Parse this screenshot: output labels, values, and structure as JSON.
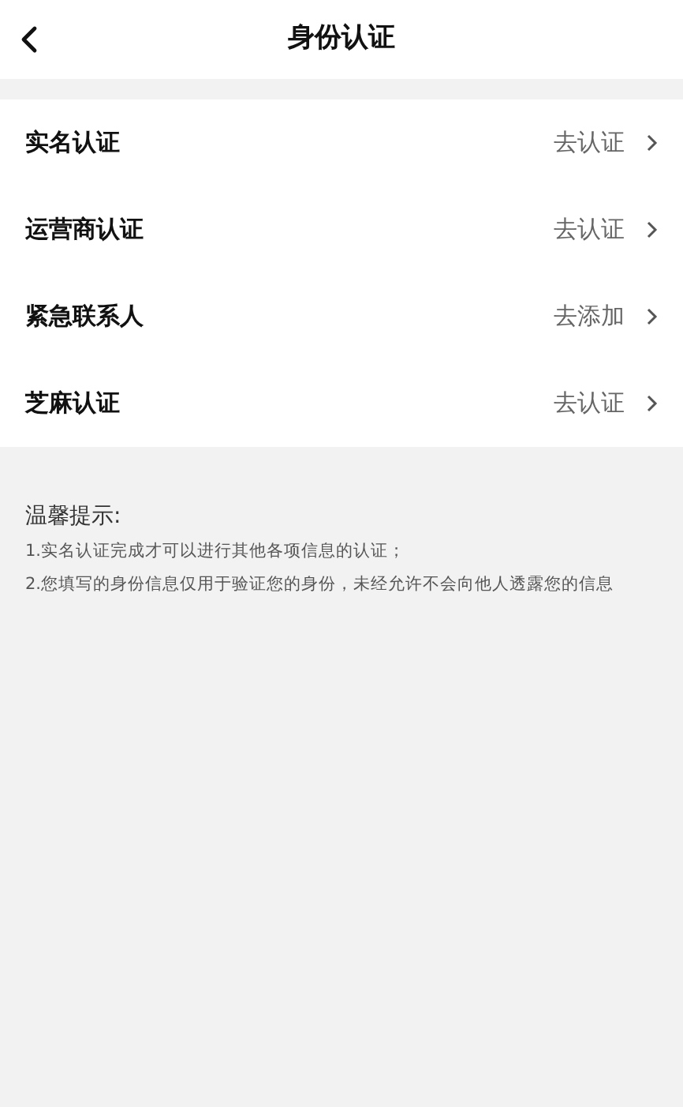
{
  "header": {
    "title": "身份认证"
  },
  "items": [
    {
      "label": "实名认证",
      "action": "去认证"
    },
    {
      "label": "运营商认证",
      "action": "去认证"
    },
    {
      "label": "紧急联系人",
      "action": "去添加"
    },
    {
      "label": "芝麻认证",
      "action": "去认证"
    }
  ],
  "tips": {
    "heading": "温馨提示:",
    "lines": [
      "1.实名认证完成才可以进行其他各项信息的认证；",
      "2.您填写的身份信息仅用于验证您的身份，未经允许不会向他人透露您的信息"
    ]
  }
}
